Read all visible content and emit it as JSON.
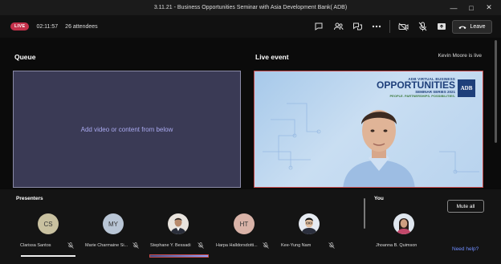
{
  "window": {
    "title": "3.11.21 - Business Opportunities Seminar with Asia Development Bank( ADB)"
  },
  "toolbar": {
    "live_badge": "LIVE",
    "elapsed": "02:11:57",
    "attendees": "26 attendees",
    "leave_label": "Leave",
    "icons": [
      "chat-icon",
      "people-icon",
      "q-and-a-icon",
      "more-icon",
      "camera-off-icon",
      "mic-off-icon",
      "share-icon"
    ]
  },
  "queue": {
    "title": "Queue",
    "placeholder": "Add video or content from below"
  },
  "live_event": {
    "title": "Live event",
    "status": "Kevin Moore is live",
    "banner": {
      "line1": "ADB VIRTUAL BUSINESS",
      "line2": "OPPORTUNITIES",
      "line3": "SEMINAR SERIES 2021",
      "line4": "PEOPLE. PARTNERSHIPS. POSSIBILITIES.",
      "logo": "ADB"
    }
  },
  "presenters": {
    "title": "Presenters",
    "items": [
      {
        "initials": "CS",
        "name": "Clarissa Santos",
        "color": "#c9c1a0"
      },
      {
        "initials": "MY",
        "name": "Marie Charmaine Si...",
        "color": "#b9c6d6"
      },
      {
        "initials": "",
        "name": "Stephane Y. Bessadi",
        "color": ""
      },
      {
        "initials": "HT",
        "name": "Harpa Halldorsdotti...",
        "color": "#d9b3a8"
      },
      {
        "initials": "",
        "name": "Kee-Yung Nam",
        "color": ""
      }
    ]
  },
  "you": {
    "title": "You",
    "name": "Jhoanna B. Quimson",
    "mute_all_label": "Mute all"
  },
  "help": {
    "label": "Need help?"
  },
  "colors": {
    "live_red": "#c4314b",
    "link_blue": "#6f8dff",
    "queue_bg": "#3a3a55"
  }
}
